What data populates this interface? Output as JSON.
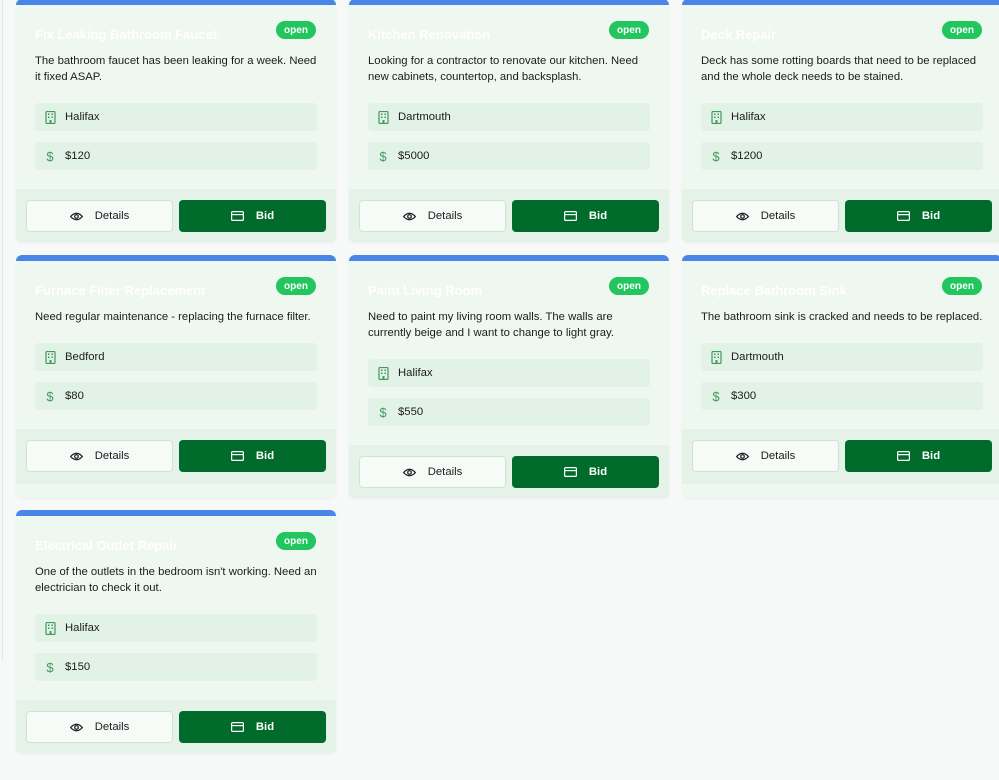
{
  "status_label": "open",
  "details_label": "Details",
  "bid_label": "Bid",
  "colors": {
    "accent_bar": "#4a86e8",
    "bid_button": "#006b2b",
    "badge": "#22c55e"
  },
  "icons": {
    "location": "building-icon",
    "price": "dollar-icon",
    "details": "eye-icon",
    "bid": "credit-card-icon"
  },
  "jobs": [
    {
      "title": "Fix Leaking Bathroom Faucet",
      "status": "open",
      "description": "The bathroom faucet has been leaking for a week. Need it fixed ASAP.",
      "location": "Halifax",
      "price": "$120"
    },
    {
      "title": "Kitchen Renovation",
      "status": "open",
      "description": "Looking for a contractor to renovate our kitchen. Need new cabinets, countertop, and backsplash.",
      "location": "Dartmouth",
      "price": "$5000"
    },
    {
      "title": "Deck Repair",
      "status": "open",
      "description": "Deck has some rotting boards that need to be replaced and the whole deck needs to be stained.",
      "location": "Halifax",
      "price": "$1200"
    },
    {
      "title": "Furnace Filter Replacement",
      "status": "open",
      "description": "Need regular maintenance - replacing the furnace filter.",
      "location": "Bedford",
      "price": "$80"
    },
    {
      "title": "Paint Living Room",
      "status": "open",
      "description": "Need to paint my living room walls. The walls are currently beige and I want to change to light gray.",
      "location": "Halifax",
      "price": "$550"
    },
    {
      "title": "Replace Bathroom Sink",
      "status": "open",
      "description": "The bathroom sink is cracked and needs to be replaced.",
      "location": "Dartmouth",
      "price": "$300"
    },
    {
      "title": "Electrical Outlet Repair",
      "status": "open",
      "description": "One of the outlets in the bedroom isn't working. Need an electrician to check it out.",
      "location": "Halifax",
      "price": "$150"
    }
  ]
}
